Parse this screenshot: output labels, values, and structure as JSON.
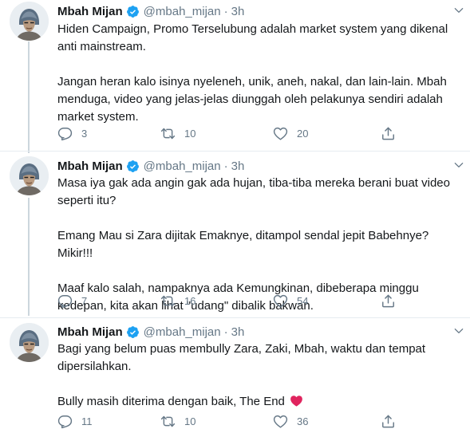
{
  "tweets": [
    {
      "name": "Mbah Mijan",
      "handle": "@mbah_mijan",
      "dot": "·",
      "time": "3h",
      "paragraphs": [
        "Hiden Campaign, Promo Terselubung adalah market system yang dikenal anti mainstream.",
        "Jangan heran kalo isinya nyeleneh, unik, aneh, nakal, dan lain-lain. Mbah menduga, video yang jelas-jelas diunggah oleh pelakunya sendiri adalah market system."
      ],
      "replies": "3",
      "retweets": "10",
      "likes": "20"
    },
    {
      "name": "Mbah Mijan",
      "handle": "@mbah_mijan",
      "dot": "·",
      "time": "3h",
      "paragraphs": [
        "Masa iya gak ada angin gak ada hujan, tiba-tiba mereka berani buat video seperti itu?",
        "Emang Mau si Zara dijitak Emaknye, ditampol sendal jepit Babehnye? Mikir!!!",
        "Maaf kalo salah, nampaknya ada Kemungkinan, dibeberapa minggu kedepan, kita akan lihat \"udang\" dibalik bakwan."
      ],
      "replies": "7",
      "retweets": "16",
      "likes": "54"
    },
    {
      "name": "Mbah Mijan",
      "handle": "@mbah_mijan",
      "dot": "·",
      "time": "3h",
      "paragraphs": [
        "Bagi yang belum puas membully Zara, Zaki, Mbah, waktu dan tempat dipersilahkan.",
        "Bully masih diterima dengan baik, The End"
      ],
      "replies": "11",
      "retweets": "10",
      "likes": "36"
    }
  ],
  "icons": {
    "verified": "verified-badge-icon",
    "caret": "chevron-down-icon",
    "reply": "reply-icon",
    "retweet": "retweet-icon",
    "like": "heart-icon",
    "share": "share-icon",
    "emoji": "red-heart-emoji-icon"
  },
  "colors": {
    "text": "#14171a",
    "secondary": "#657786",
    "verified": "#1da1f2",
    "divider": "#e6ecf0",
    "heart_emoji": "#e0245e"
  }
}
